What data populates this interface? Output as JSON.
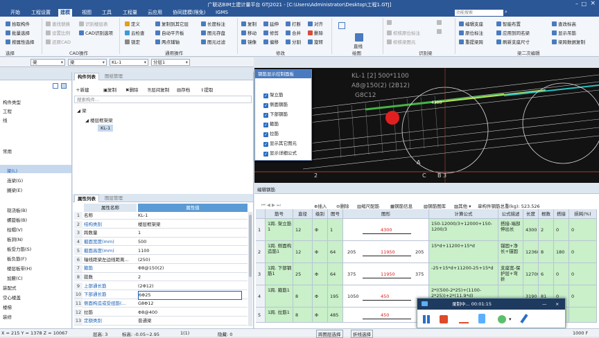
{
  "title": "广联达BIM土建计量平台 GTJ2021 - [C:\\Users\\Administrator\\Desktop\\工程1.GTJ]",
  "menu_tabs": [
    "开始",
    "工程设置",
    "建模",
    "视图",
    "工具",
    "工程量",
    "云应用",
    "协同建模(限免)",
    "IGMS"
  ],
  "search_placeholder": "功能搜索",
  "ribbon": {
    "g1": [
      "拾取构件",
      "批量选择",
      "按属性选择"
    ],
    "g2": [
      "查找替换",
      "设置比例",
      "还原CAD"
    ],
    "g3": [
      "识别楼层表",
      "CAD识别选项"
    ],
    "g4": [
      "定义",
      "云检查",
      "锁定"
    ],
    "g5": [
      "复制到其它层",
      "自动平齐板",
      "两点辅轴"
    ],
    "g6": [
      "长度标注",
      "图元存盘",
      "图元过滤"
    ],
    "g7": [
      "复制",
      "移动",
      "镜像"
    ],
    "g8": [
      "延伸",
      "修剪",
      "偏移"
    ],
    "g9": [
      "打断",
      "合并",
      "分割"
    ],
    "g10": [
      "对齐",
      "删除",
      "旋转"
    ],
    "draw": [
      "直线"
    ],
    "g11": [
      "校核原位标注",
      "校核梁图元"
    ],
    "g12": [
      "编辑支座",
      "原位标注",
      "重提梁跨"
    ],
    "g13": [
      "智能布置",
      "应用到同名梁",
      "刷新支座尺寸"
    ],
    "g14": [
      "查改标高",
      "显示吊筋",
      "梁跨数据复制"
    ],
    "group_labels": [
      "选择",
      "CAD操作",
      "通用操作",
      "修改",
      "绘图",
      "识别梁",
      "梁二次编辑"
    ]
  },
  "tooltip": "开始",
  "selectors": [
    "梁",
    "梁",
    "KL-1",
    "分层1"
  ],
  "left_panel": {
    "items_top": [
      "构件类型",
      "工程",
      "线"
    ],
    "section": "常用",
    "items": [
      "梁(L)",
      "连梁(G)",
      "圈梁(E)",
      "现浇板(B)",
      "螺旋板(B)",
      "柱帽(V)",
      "板洞(N)",
      "板受力筋(S)",
      "板负筋(F)",
      "楼层板带(H)",
      "加腋(C)",
      "装配式",
      "空心楼盖",
      "楼梯",
      "装修"
    ]
  },
  "component_list": {
    "tabs": [
      "构件列表",
      "图纸管理"
    ],
    "toolbar": [
      "新建",
      "复制",
      "删除",
      "层间复制",
      "存档",
      "提取"
    ],
    "search": "搜索构件...",
    "tree": [
      "梁",
      "楼层框架梁",
      "KL-1"
    ]
  },
  "property_list": {
    "tabs": [
      "属性列表",
      "图层管理"
    ],
    "headers": [
      "属性名称",
      "属性值"
    ],
    "rows": [
      {
        "n": "1",
        "k": "名称",
        "v": "KL-1"
      },
      {
        "n": "2",
        "k": "结构类别",
        "v": "楼层框架梁"
      },
      {
        "n": "3",
        "k": "跨数量",
        "v": "1"
      },
      {
        "n": "4",
        "k": "截面宽度(mm)",
        "v": "500"
      },
      {
        "n": "5",
        "k": "截面高度(mm)",
        "v": "1100"
      },
      {
        "n": "6",
        "k": "轴线距梁左边线距离...",
        "v": "(250)"
      },
      {
        "n": "7",
        "k": "箍筋",
        "v": "Φ8@150(2)"
      },
      {
        "n": "8",
        "k": "肢数",
        "v": "2"
      },
      {
        "n": "9",
        "k": "上部通长筋",
        "v": "(2Φ12)"
      },
      {
        "n": "10",
        "k": "下部通长筋",
        "v": "6Φ25"
      },
      {
        "n": "11",
        "k": "侧面构造或受扭筋(...",
        "v": "G8Φ12"
      },
      {
        "n": "12",
        "k": "拉筋",
        "v": "Φ8@400"
      },
      {
        "n": "13",
        "k": "定额类别",
        "v": "普通梁"
      }
    ]
  },
  "rebar_display": {
    "title": "钢筋显示控制面板",
    "items": [
      "架立筋",
      "侧面钢筋",
      "下部钢筋",
      "箍筋",
      "拉筋",
      "显示其它图元",
      "显示详细公式"
    ]
  },
  "viewport": {
    "labels": [
      "KL-1 [2] 500*1100",
      "A8@150(2) (2B12)",
      "G8C12",
      "4300",
      "A",
      "B",
      "C",
      "3",
      "2"
    ]
  },
  "rebar_edit": {
    "title": "编辑钢筋",
    "toolbar": [
      "插入",
      "删除",
      "缩尺配筋",
      "钢筋信息",
      "钢筋图库",
      "其他",
      "单构件钢筋总重(kg): 523.526"
    ],
    "headers": [
      "筋号",
      "直径(mm)",
      "级别",
      "图号",
      "图形",
      "计算公式",
      "公式描述",
      "长度",
      "根数",
      "搭接",
      "损耗(%)"
    ],
    "rows": [
      {
        "name": "1跨. 架立筋1",
        "dia": "12",
        "grade": "Φ",
        "fig": "1",
        "shape_l": "",
        "shape_m": "4300",
        "shape_r": "",
        "formula": "150-12000/3+12000+150-1200/3",
        "desc": "搭接-端部伸出长",
        "len": "4300",
        "cnt": "2",
        "lap": "0",
        "loss": "0"
      },
      {
        "name": "1跨. 侧面构造筋1",
        "dia": "12",
        "grade": "Φ",
        "fig": "64",
        "shape_l": "205",
        "shape_m": "11950",
        "shape_r": "205",
        "formula": "15*d+11200+15*d",
        "desc": "锚固+净长+锚固",
        "len": "12360",
        "cnt": "8",
        "lap": "180",
        "loss": "0"
      },
      {
        "name": "1跨. 下部钢筋1",
        "dia": "25",
        "grade": "Φ",
        "fig": "64",
        "shape_l": "375",
        "shape_m": "11950",
        "shape_r": "375",
        "formula": "-25+15*d+11200-25+15*d",
        "desc": "支座宽-保护层+弯折",
        "len": "12700",
        "cnt": "6",
        "lap": "0",
        "loss": "0"
      },
      {
        "name": "1跨. 箍筋1",
        "dia": "8",
        "grade": "Φ",
        "fig": "195",
        "shape_l": "1050",
        "shape_m": "450",
        "shape_r": "",
        "formula": "2*((500-2*25)+(1100-2*25))+2*(11.9*d)",
        "desc": "",
        "len": "3190",
        "cnt": "81",
        "lap": "0",
        "loss": "0"
      },
      {
        "name": "1跨. 拉筋1",
        "dia": "8",
        "grade": "Φ",
        "fig": "485",
        "shape_l": "",
        "shape_m": "450",
        "shape_r": "",
        "formula": "",
        "desc": "",
        "len": "",
        "cnt": "",
        "lap": "",
        "loss": ""
      }
    ]
  },
  "recorder": {
    "label": "录制中... 00:01:15"
  },
  "status": [
    "X = 215 Y = 1378 Z = 10067",
    "层高: 3",
    "标高: -0.05~2.95",
    "1(1)",
    "隐藏: 0",
    "跨图层选择",
    "折线选择",
    "1000 F"
  ],
  "colors": {
    "accent": "#2b5797",
    "green": "#c9f0c9",
    "highlight": "#1a5fb4"
  }
}
